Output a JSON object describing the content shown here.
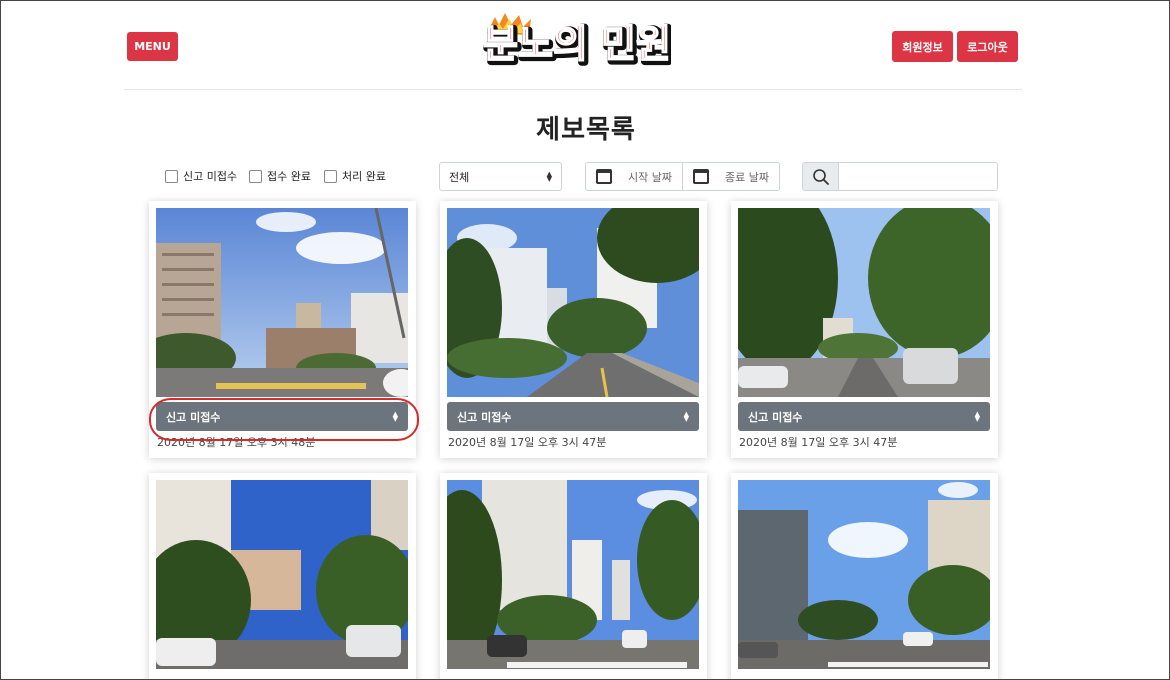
{
  "header": {
    "menu_label": "MENU",
    "logo_text": "분노의 민원",
    "member_info_label": "회원정보",
    "logout_label": "로그아웃"
  },
  "page_title": "제보목록",
  "filters": {
    "checkboxes": [
      {
        "label": "신고 미접수",
        "checked": false
      },
      {
        "label": "접수 완료",
        "checked": false
      },
      {
        "label": "처리 완료",
        "checked": false
      }
    ],
    "category_select": "전체",
    "start_date_placeholder": "시작 날짜",
    "end_date_placeholder": "종료 날짜",
    "search_value": ""
  },
  "reports": [
    {
      "status": "신고 미접수",
      "date": "2020년 8월 17일 오후 3시 48분"
    },
    {
      "status": "신고 미접수",
      "date": "2020년 8월 17일 오후 3시 47분"
    },
    {
      "status": "신고 미접수",
      "date": "2020년 8월 17일 오후 3시 47분"
    },
    {
      "status": "",
      "date": ""
    },
    {
      "status": "",
      "date": ""
    },
    {
      "status": "",
      "date": ""
    }
  ],
  "colors": {
    "brand_red": "#dc3545",
    "status_gray": "#6c757d",
    "highlight_red": "#d42b2b"
  }
}
